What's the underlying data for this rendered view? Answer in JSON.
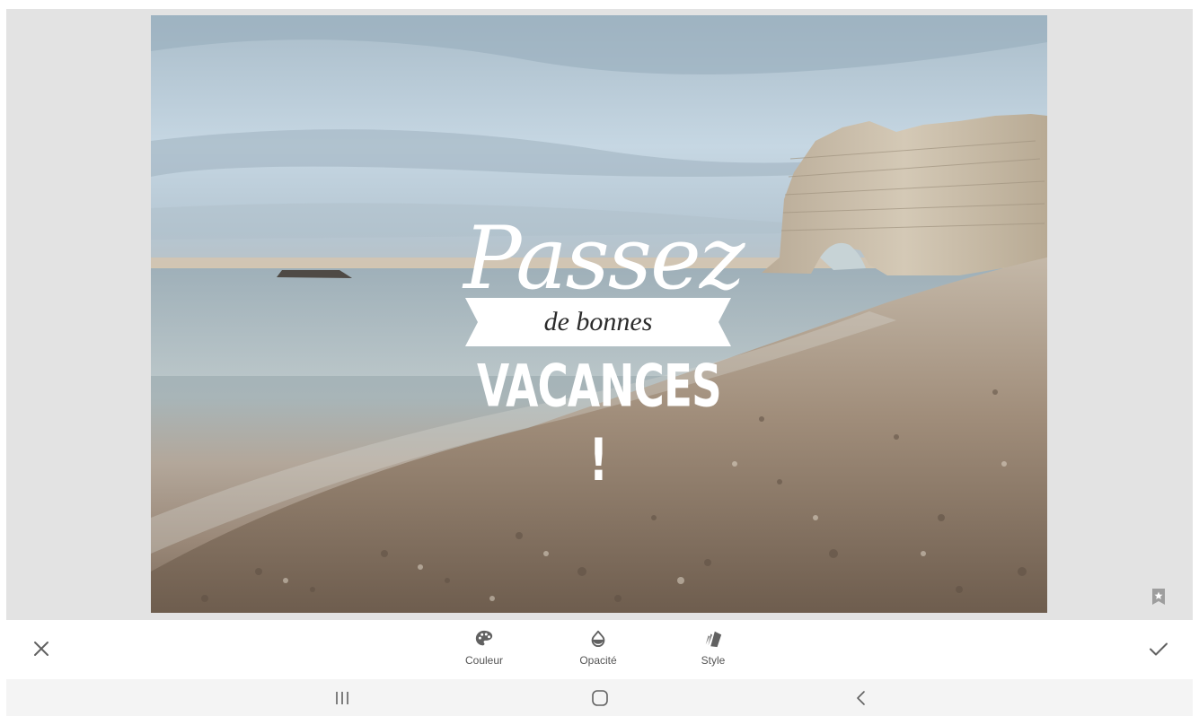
{
  "editor": {
    "overlay": {
      "line1": "Passez",
      "line2": "de bonnes",
      "line3": "VACANCES !"
    }
  },
  "toolbar": {
    "tools": [
      {
        "label": "Couleur",
        "icon": "palette-icon"
      },
      {
        "label": "Opacité",
        "icon": "water-drop-icon"
      },
      {
        "label": "Style",
        "icon": "swatches-icon"
      }
    ],
    "close_icon": "close-icon",
    "apply_icon": "checkmark-icon"
  },
  "navbar": {
    "recents_icon": "recents-icon",
    "home_icon": "home-icon",
    "back_icon": "back-icon"
  },
  "colors": {
    "canvas_background": "#e3e3e3",
    "toolbar_background": "#ffffff",
    "navbar_background": "#f4f4f4",
    "icon_color": "#616161"
  }
}
